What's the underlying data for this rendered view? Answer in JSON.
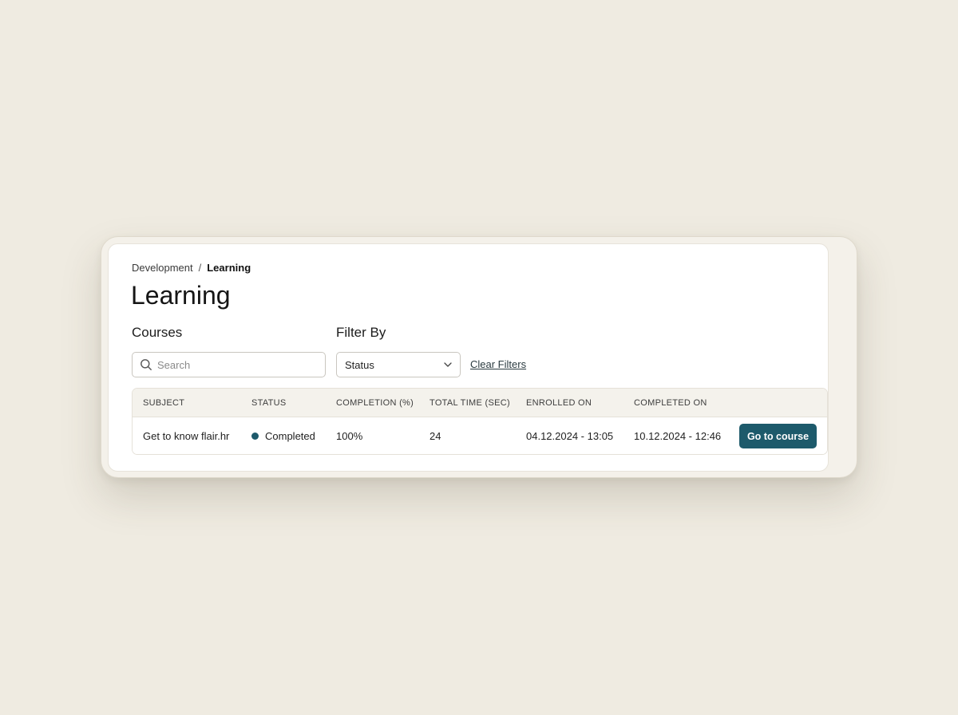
{
  "breadcrumb": {
    "parent": "Development",
    "separator": "/",
    "current": "Learning"
  },
  "page_title": "Learning",
  "sections": {
    "courses_label": "Courses",
    "filter_label": "Filter By"
  },
  "search": {
    "placeholder": "Search",
    "value": "",
    "icon": "search-icon"
  },
  "status_filter": {
    "selected": "Status",
    "icon": "chevron-down-icon"
  },
  "clear_filters_label": "Clear Filters",
  "table": {
    "columns": [
      "SUBJECT",
      "STATUS",
      "COMPLETION (%)",
      "TOTAL TIME (SEC)",
      "ENROLLED ON",
      "COMPLETED ON"
    ],
    "rows": [
      {
        "subject": "Get to know flair.hr",
        "status": "Completed",
        "completion": "100%",
        "total_time": "24",
        "enrolled_on": "04.12.2024 - 13:05",
        "completed_on": "10.12.2024 - 12:46",
        "action_label": "Go to course"
      }
    ]
  },
  "colors": {
    "accent": "#1d5a6b",
    "background": "#efebe1",
    "header_bg": "#f4f2ec"
  }
}
